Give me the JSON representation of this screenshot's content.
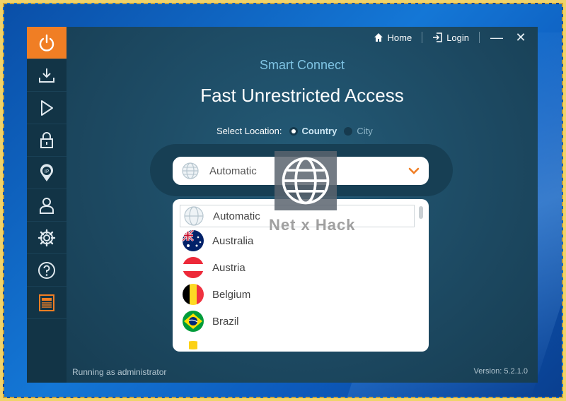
{
  "topbar": {
    "home_label": "Home",
    "login_label": "Login",
    "minimize_glyph": "—",
    "close_glyph": "✕"
  },
  "header": {
    "subtitle": "Smart Connect",
    "title": "Fast Unrestricted Access"
  },
  "location": {
    "label": "Select Location:",
    "options": [
      "Country",
      "City"
    ],
    "selected": "Country"
  },
  "select": {
    "value": "Automatic"
  },
  "dropdown": {
    "items": [
      {
        "label": "Automatic",
        "icon": "globe-icon"
      },
      {
        "label": "Australia",
        "icon": "flag-australia"
      },
      {
        "label": "Austria",
        "icon": "flag-austria"
      },
      {
        "label": "Belgium",
        "icon": "flag-belgium"
      },
      {
        "label": "Brazil",
        "icon": "flag-brazil"
      }
    ]
  },
  "sidebar": {
    "items": [
      {
        "icon": "power-icon"
      },
      {
        "icon": "download-icon"
      },
      {
        "icon": "play-icon"
      },
      {
        "icon": "lock-icon"
      },
      {
        "icon": "ip-location-icon"
      },
      {
        "icon": "user-icon"
      },
      {
        "icon": "settings-icon"
      },
      {
        "icon": "help-icon"
      },
      {
        "icon": "news-icon"
      }
    ]
  },
  "watermark": {
    "text": "Net x Hack"
  },
  "footer": {
    "status": "Running as administrator",
    "version": "Version:  5.2.1.0"
  },
  "colors": {
    "accent": "#f07e24",
    "sidebar_bg": "#123446",
    "main_bg": "#1d4a63",
    "subtitle": "#7fc4e4"
  }
}
